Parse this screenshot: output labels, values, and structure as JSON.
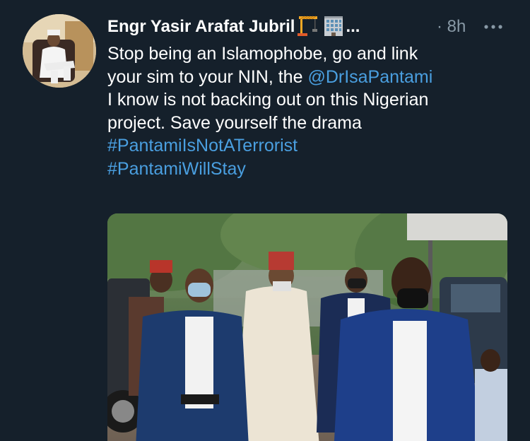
{
  "tweet": {
    "author_name": "Engr Yasir Arafat Jubril",
    "name_ellipsis": "...",
    "timestamp": "8h",
    "text_lines": {
      "line1": "Stop being an Islamophobe, go and link",
      "line2_a": "your sim to your NIN, the ",
      "mention": "@DrIsaPantami",
      "line3": "I know is not backing out on this Nigerian",
      "line4": "project. Save yourself the drama",
      "hashtag1": "#PantamiIsNotATerrorist",
      "hashtag2": "#PantamiWillStay"
    }
  },
  "icons": {
    "author_emoji_1": "construction-crane-icon",
    "author_emoji_2": "office-building-icon",
    "more": "more-dots-icon",
    "time_separator": "dot"
  },
  "colors": {
    "background": "#15202b",
    "text": "#ffffff",
    "secondary_text": "#8899a6",
    "link": "#4a9fe0"
  }
}
